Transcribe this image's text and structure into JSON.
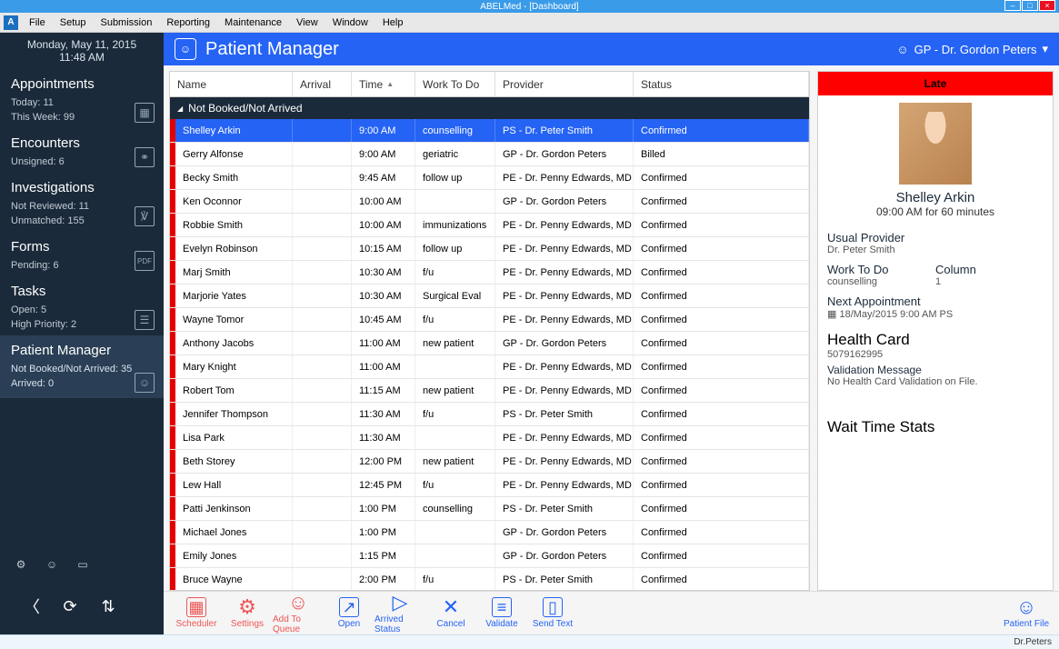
{
  "window": {
    "title": "ABELMed - [Dashboard]"
  },
  "menu": [
    "File",
    "Setup",
    "Submission",
    "Reporting",
    "Maintenance",
    "View",
    "Window",
    "Help"
  ],
  "sidebar": {
    "date": "Monday, May 11, 2015",
    "time": "11:48 AM",
    "appointments": {
      "title": "Appointments",
      "today": "Today: 11",
      "week": "This Week: 99"
    },
    "encounters": {
      "title": "Encounters",
      "unsigned": "Unsigned: 6"
    },
    "investigations": {
      "title": "Investigations",
      "notreviewed": "Not Reviewed: 11",
      "unmatched": "Unmatched: 155"
    },
    "forms": {
      "title": "Forms",
      "pending": "Pending: 6"
    },
    "tasks": {
      "title": "Tasks",
      "open": "Open: 5",
      "high": "High Priority: 2"
    },
    "pm": {
      "title": "Patient Manager",
      "notbooked": "Not Booked/Not Arrived: 35",
      "arrived": "Arrived: 0"
    }
  },
  "header": {
    "title": "Patient Manager",
    "user": "GP - Dr. Gordon Peters"
  },
  "columns": {
    "name": "Name",
    "arrival": "Arrival",
    "time": "Time",
    "work": "Work To Do",
    "provider": "Provider",
    "status": "Status"
  },
  "group_label": "Not Booked/Not Arrived",
  "rows": [
    {
      "name": "Shelley Arkin",
      "arrival": "",
      "time": "9:00 AM",
      "work": "counselling",
      "provider": "PS - Dr. Peter Smith",
      "status": "Confirmed",
      "selected": true
    },
    {
      "name": "Gerry Alfonse",
      "arrival": "",
      "time": "9:00 AM",
      "work": "geriatric",
      "provider": "GP - Dr. Gordon Peters",
      "status": "Billed"
    },
    {
      "name": "Becky Smith",
      "arrival": "",
      "time": "9:45 AM",
      "work": "follow up",
      "provider": "PE - Dr. Penny Edwards, MD",
      "status": "Confirmed"
    },
    {
      "name": "Ken Oconnor",
      "arrival": "",
      "time": "10:00 AM",
      "work": "",
      "provider": "GP - Dr. Gordon Peters",
      "status": "Confirmed"
    },
    {
      "name": "Robbie Smith",
      "arrival": "",
      "time": "10:00 AM",
      "work": "immunizations",
      "provider": "PE - Dr. Penny Edwards, MD",
      "status": "Confirmed"
    },
    {
      "name": "Evelyn Robinson",
      "arrival": "",
      "time": "10:15 AM",
      "work": "follow up",
      "provider": "PE - Dr. Penny Edwards, MD",
      "status": "Confirmed"
    },
    {
      "name": "Marj Smith",
      "arrival": "",
      "time": "10:30 AM",
      "work": "f/u",
      "provider": "PE - Dr. Penny Edwards, MD",
      "status": "Confirmed"
    },
    {
      "name": "Marjorie Yates",
      "arrival": "",
      "time": "10:30 AM",
      "work": "Surgical Eval",
      "provider": "PE - Dr. Penny Edwards, MD",
      "status": "Confirmed"
    },
    {
      "name": "Wayne Tomor",
      "arrival": "",
      "time": "10:45 AM",
      "work": "f/u",
      "provider": "PE - Dr. Penny Edwards, MD",
      "status": "Confirmed"
    },
    {
      "name": "Anthony Jacobs",
      "arrival": "",
      "time": "11:00 AM",
      "work": "new patient",
      "provider": "GP - Dr. Gordon Peters",
      "status": "Confirmed"
    },
    {
      "name": "Mary Knight",
      "arrival": "",
      "time": "11:00 AM",
      "work": "",
      "provider": "PE - Dr. Penny Edwards, MD",
      "status": "Confirmed"
    },
    {
      "name": "Robert Tom",
      "arrival": "",
      "time": "11:15 AM",
      "work": "new patient",
      "provider": "PE - Dr. Penny Edwards, MD",
      "status": "Confirmed"
    },
    {
      "name": "Jennifer Thompson",
      "arrival": "",
      "time": "11:30 AM",
      "work": "f/u",
      "provider": "PS - Dr. Peter Smith",
      "status": "Confirmed"
    },
    {
      "name": "Lisa Park",
      "arrival": "",
      "time": "11:30 AM",
      "work": "",
      "provider": "PE - Dr. Penny Edwards, MD",
      "status": "Confirmed"
    },
    {
      "name": "Beth Storey",
      "arrival": "",
      "time": "12:00 PM",
      "work": "new patient",
      "provider": "PE - Dr. Penny Edwards, MD",
      "status": "Confirmed"
    },
    {
      "name": "Lew Hall",
      "arrival": "",
      "time": "12:45 PM",
      "work": "f/u",
      "provider": "PE - Dr. Penny Edwards, MD",
      "status": "Confirmed"
    },
    {
      "name": "Patti Jenkinson",
      "arrival": "",
      "time": "1:00 PM",
      "work": "counselling",
      "provider": "PS - Dr. Peter Smith",
      "status": "Confirmed"
    },
    {
      "name": "Michael Jones",
      "arrival": "",
      "time": "1:00 PM",
      "work": "",
      "provider": "GP - Dr. Gordon Peters",
      "status": "Confirmed"
    },
    {
      "name": "Emily Jones",
      "arrival": "",
      "time": "1:15 PM",
      "work": "",
      "provider": "GP - Dr. Gordon Peters",
      "status": "Confirmed"
    },
    {
      "name": "Bruce Wayne",
      "arrival": "",
      "time": "2:00 PM",
      "work": "f/u",
      "provider": "PS - Dr. Peter Smith",
      "status": "Confirmed"
    }
  ],
  "info": {
    "late": "Late",
    "name": "Shelley Arkin",
    "appt": "09:00 AM for 60 minutes",
    "usual_provider_label": "Usual Provider",
    "usual_provider": "Dr. Peter Smith",
    "work_label": "Work To Do",
    "column_label": "Column",
    "work_value": "counselling",
    "column_value": "1",
    "next_label": "Next Appointment",
    "next_value": "18/May/2015 9:00 AM PS",
    "hcard_label": "Health Card",
    "hcard_value": "5079162995",
    "validation_label": "Validation Message",
    "validation_value": "No Health Card Validation on File.",
    "wait_label": "Wait Time Stats"
  },
  "actions": {
    "scheduler": "Scheduler",
    "settings": "Settings",
    "add": "Add To Queue",
    "open": "Open",
    "arrived": "Arrived Status",
    "cancel": "Cancel",
    "validate": "Validate",
    "send": "Send Text",
    "patientfile": "Patient File"
  },
  "statusbar": "Dr.Peters"
}
